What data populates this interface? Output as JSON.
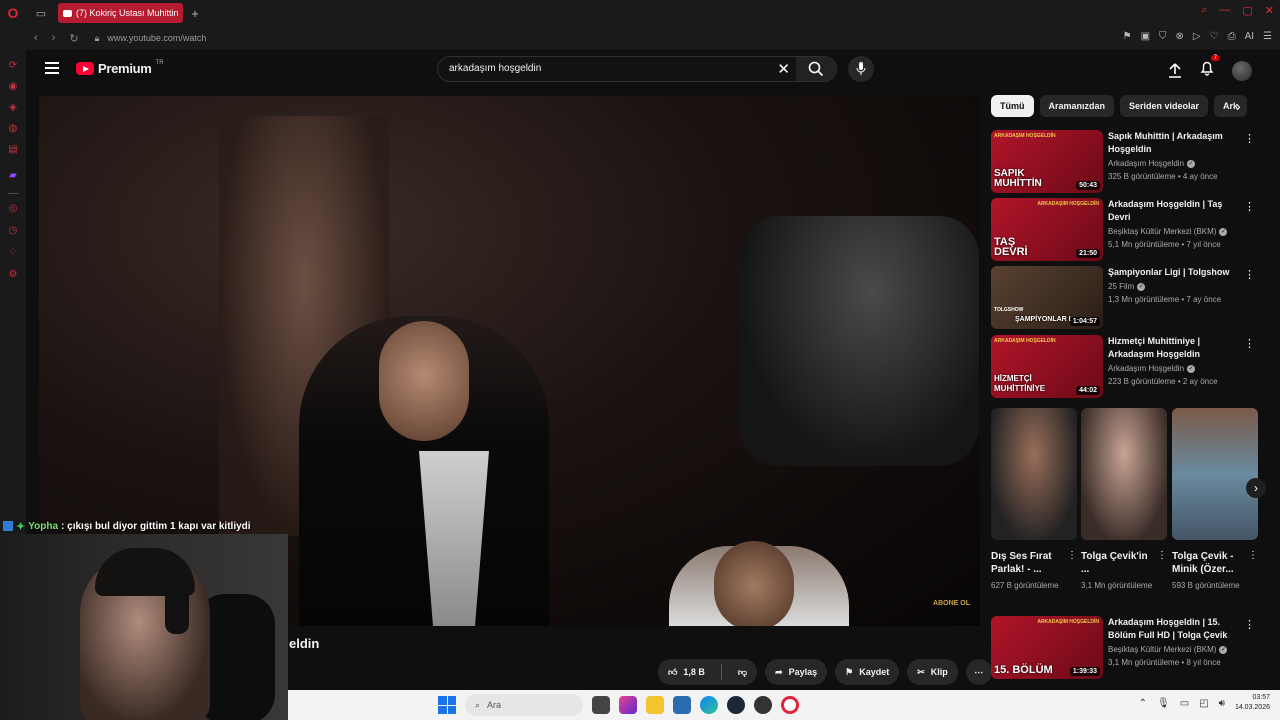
{
  "browser": {
    "tab_title": "(7) Kokiriç Ustası Muhittin",
    "url": "www.youtube.com/watch",
    "ai_label": "AI"
  },
  "youtube": {
    "logo_text": "Premium",
    "logo_tm": "TR",
    "search_query": "arkadaşım hoşgeldin",
    "notifications_count": "7"
  },
  "player": {
    "watermark": "ABONE OL"
  },
  "video": {
    "title_visible": "eldin",
    "like_count": "1,8 B",
    "share_label": "Paylaş",
    "save_label": "Kaydet",
    "clip_label": "Klip"
  },
  "chips": [
    "Tümü",
    "Aramanızdan",
    "Seriden videolar",
    "Ark"
  ],
  "recommendations": [
    {
      "title": "Sapık Muhittin | Arkadaşım Hoşgeldin",
      "channel": "Arkadaşım Hoşgeldin",
      "meta": "325 B görüntüleme • 4 ay önce",
      "duration": "50:43",
      "thumb_caption": "SAPIK MUHİTTİN",
      "thumb_brand": "ARKADAŞIM HOŞGELDİN"
    },
    {
      "title": "Arkadaşım Hoşgeldin | Taş Devri",
      "channel": "Beşiktaş Kültür Merkezi (BKM)",
      "meta": "5,1 Mn görüntüleme • 7 yıl önce",
      "duration": "21:50",
      "thumb_caption": "TAŞ DEVRİ",
      "thumb_brand": "ARKADAŞIM HOŞGELDİN"
    },
    {
      "title": "Şampiyonlar Ligi | Tolgshow",
      "channel": "25 Film",
      "meta": "1,3 Mn görüntüleme • 7 ay önce",
      "duration": "1:04:57",
      "thumb_caption": "ŞAMPİYONLAR L",
      "thumb_brand": "TOLGSHOW"
    },
    {
      "title": "Hizmetçi Muhittiniye | Arkadaşım Hoşgeldin",
      "channel": "Arkadaşım Hoşgeldin",
      "meta": "223 B görüntüleme • 2 ay önce",
      "duration": "44:02",
      "thumb_caption": "HİZMETÇİ MUHİTTİNİYE",
      "thumb_brand": "ARKADAŞIM HOŞGELDİN"
    },
    {
      "title": "Arkadaşım Hoşgeldin | 15. Bölüm Full HD | Tolga Çevik",
      "channel": "Beşiktaş Kültür Merkezi (BKM)",
      "meta": "3,1 Mn görüntüleme • 8 yıl önce",
      "duration": "1:39:33",
      "thumb_caption": "15. BÖLÜM",
      "thumb_brand": "ARKADAŞIM HOŞGELDİN"
    }
  ],
  "shorts": [
    {
      "title": "Dış Ses Fırat Parlak! - ...",
      "views": "627 B görüntüleme"
    },
    {
      "title": "Tolga Çevik'in ...",
      "views": "3,1 Mn görüntüleme"
    },
    {
      "title": "Tolga Çevik - Minik (Özer...",
      "views": "593 B görüntüleme"
    }
  ],
  "stream": {
    "chat_user": "Yopha",
    "chat_message": ": çıkışı bul diyor gittim 1 kapı var kitliydi"
  },
  "taskbar": {
    "search_placeholder": "Ara",
    "time": "03:57",
    "date": "14.03.2026"
  }
}
